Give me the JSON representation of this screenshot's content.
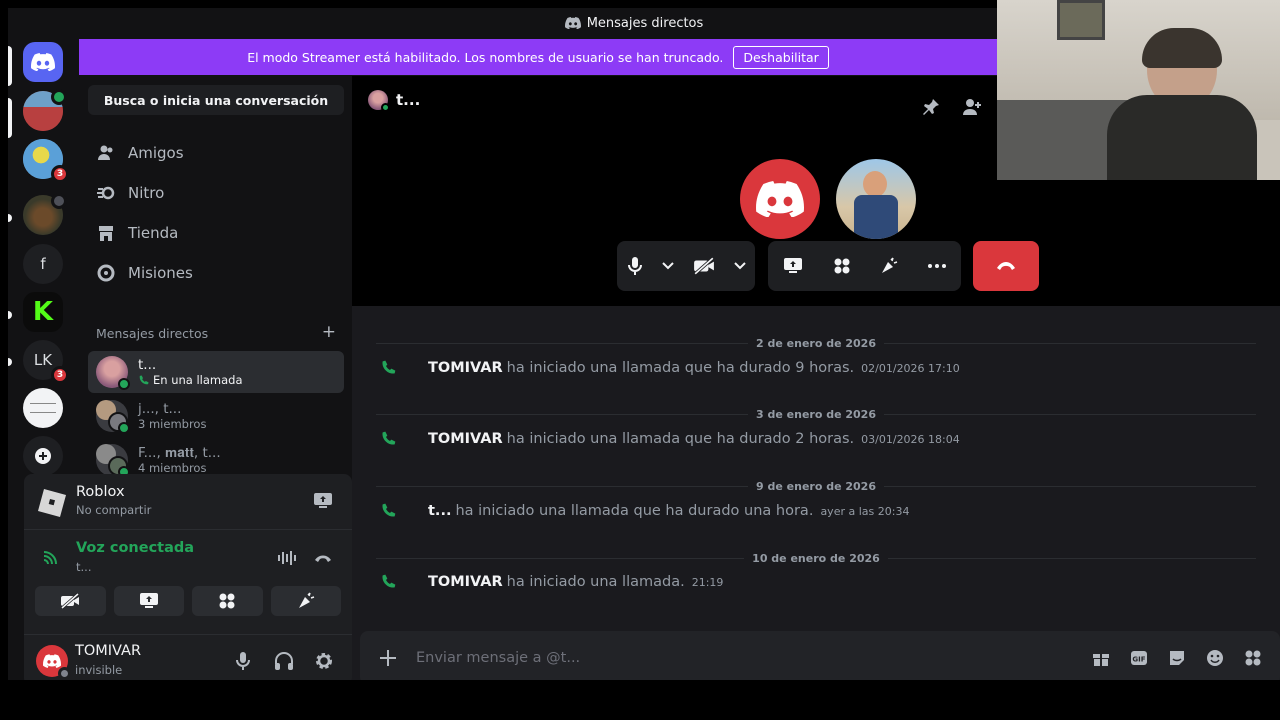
{
  "titlebar": {
    "title": "Mensajes directos"
  },
  "servers": [
    {
      "name": "home",
      "label": ""
    },
    {
      "name": "server-avatar-1",
      "label": ""
    },
    {
      "name": "server-avatar-2",
      "label": "",
      "badge": "3"
    },
    {
      "name": "server-avatar-3",
      "label": ""
    },
    {
      "name": "server-f",
      "label": "f"
    },
    {
      "name": "server-k",
      "label": ""
    },
    {
      "name": "server-lk",
      "label": "LK",
      "badge": "3"
    },
    {
      "name": "server-white",
      "label": ""
    },
    {
      "name": "add-server",
      "label": ""
    }
  ],
  "banner": {
    "text": "El modo Streamer está habilitado. Los nombres de usuario se han truncado.",
    "button": "Deshabilitar"
  },
  "sidebar": {
    "search": "Busca o inicia una conversación",
    "nav": [
      "Amigos",
      "Nitro",
      "Tienda",
      "Misiones"
    ],
    "dm_header": "Mensajes directos",
    "dms": [
      {
        "name": "t...",
        "sub": "En una llamada"
      },
      {
        "name": "j..., t...",
        "sub": "3 miembros"
      },
      {
        "name": "F..., 𝐦𝐚𝐭𝐭, t...",
        "sub": "4 miembros"
      }
    ]
  },
  "activity": {
    "title": "Roblox",
    "sub": "No compartir"
  },
  "voice": {
    "status": "Voz conectada",
    "channel": "t..."
  },
  "user": {
    "name": "TOMIVAR",
    "status": "invisible"
  },
  "channel": {
    "name": "t..."
  },
  "messages": [
    {
      "date": "2 de enero de 2026",
      "who": "TOMIVAR",
      "text": "ha iniciado una llamada que ha durado 9 horas.",
      "time": "02/01/2026 17:10"
    },
    {
      "date": "3 de enero de 2026",
      "who": "TOMIVAR",
      "text": "ha iniciado una llamada que ha durado 2 horas.",
      "time": "03/01/2026 18:04"
    },
    {
      "date": "9 de enero de 2026",
      "who": "t...",
      "text": "ha iniciado una llamada que ha durado una hora.",
      "time": "ayer a las 20:34"
    },
    {
      "date": "10 de enero de 2026",
      "who": "TOMIVAR",
      "text": "ha iniciado una llamada.",
      "time": "21:19"
    }
  ],
  "composer": {
    "placeholder": "Enviar mensaje a @t..."
  },
  "colors": {
    "accent": "#5865f2",
    "banner": "#8d3bf6",
    "danger": "#da373c",
    "online": "#23a55a"
  }
}
